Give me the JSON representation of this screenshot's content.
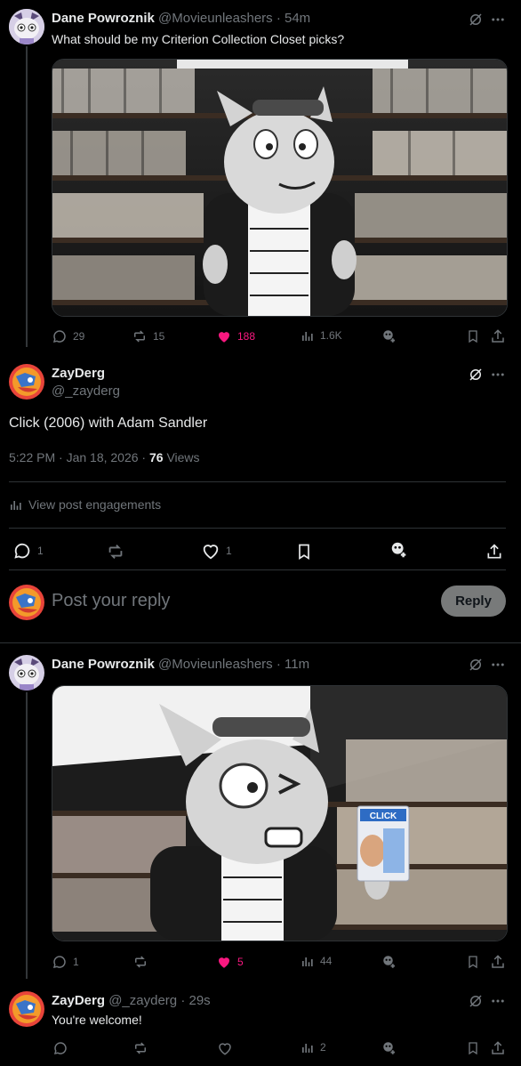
{
  "post1": {
    "author": "Dane Powroznik",
    "handle": "@Movieunleashers",
    "time": "54m",
    "text": "What should be my Criterion Collection Closet picks?",
    "replies": "29",
    "reposts": "15",
    "likes": "188",
    "views": "1.6K"
  },
  "main": {
    "author": "ZayDerg",
    "handle": "@_zayderg",
    "text": "Click (2006) with Adam Sandler",
    "datetime": "5:22 PM · Jan 18, 2026 · ",
    "views_count": "76",
    "views_label": " Views",
    "engagements": "View post engagements",
    "replies": "1",
    "likes": "1"
  },
  "composer": {
    "placeholder": "Post your reply",
    "button": "Reply"
  },
  "post2": {
    "author": "Dane Powroznik",
    "handle": "@Movieunleashers",
    "time": "11m",
    "dvd_title": "CLICK",
    "replies": "1",
    "likes": "5",
    "views": "44"
  },
  "post3": {
    "author": "ZayDerg",
    "handle": "@_zayderg",
    "time": "29s",
    "text": "You're welcome!",
    "views": "2"
  },
  "colors": {
    "like_active": "#f91880",
    "muted": "#71767b",
    "divider": "#2f3336"
  }
}
